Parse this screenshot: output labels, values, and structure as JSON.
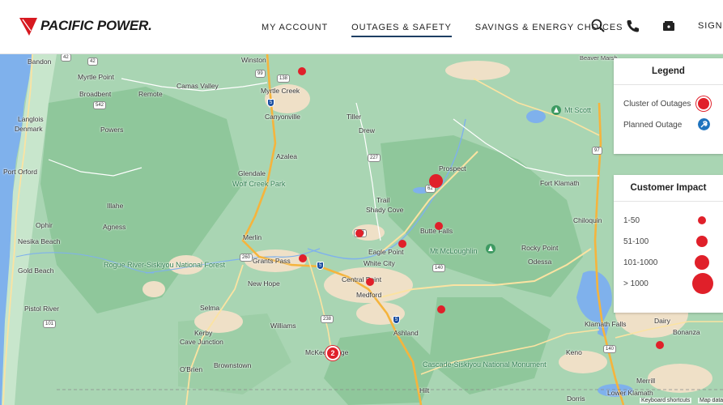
{
  "header": {
    "brand": "PACIFIC POWER.",
    "nav": [
      {
        "label": "MY ACCOUNT",
        "active": false
      },
      {
        "label": "OUTAGES & SAFETY",
        "active": true
      },
      {
        "label": "SAVINGS & ENERGY CHOICES",
        "active": false
      }
    ],
    "icons": [
      "search-icon",
      "phone-icon",
      "wallet-icon"
    ],
    "sign_in": "SIGN IN"
  },
  "legend": {
    "title": "Legend",
    "items": [
      {
        "label": "Cluster of Outages",
        "icon": "cluster-icon"
      },
      {
        "label": "Planned Outage",
        "icon": "planned-outage-icon"
      }
    ]
  },
  "customer_impact": {
    "title": "Customer Impact",
    "items": [
      {
        "label": "1-50"
      },
      {
        "label": "51-100"
      },
      {
        "label": "101-1000"
      },
      {
        "label": "> 1000"
      }
    ]
  },
  "map": {
    "places": [
      "Bandon",
      "Winston",
      "Myrtle Point",
      "Camas Valley",
      "Myrtle Creek",
      "Broadbent",
      "Remote",
      "Beaver Marsh",
      "Langlois",
      "Denmark",
      "Powers",
      "Canyonville",
      "Tiller",
      "Drew",
      "Mt Scott",
      "Azalea",
      "Prospect",
      "Port Orford",
      "Glendale",
      "Wolf Creek Park",
      "Fort Klamath",
      "Illahe",
      "Trail",
      "Shady Cove",
      "Agness",
      "Chiloquin",
      "Ophir",
      "Butte Falls",
      "Nesika Beach",
      "Merlin",
      "Eagle Point",
      "Mt McLoughlin",
      "Rocky Point",
      "Grants Pass",
      "White City",
      "Odessa",
      "Gold Beach",
      "Rogue River-Siskiyou National Forest",
      "New Hope",
      "Central Point",
      "Medford",
      "Pistol River",
      "Selma",
      "Williams",
      "Klamath Falls",
      "Kerby",
      "Cave Junction",
      "Ashland",
      "Dairy",
      "Bonanza",
      "Brownstown",
      "McKee Bridge",
      "Keno",
      "O'Brien",
      "Cascade-Siskiyou National Monument",
      "Merrill",
      "Hilt",
      "Dorris",
      "Lower Klamath"
    ],
    "highways": [
      "42",
      "99",
      "138",
      "542",
      "227",
      "62",
      "97",
      "234",
      "260",
      "5",
      "140",
      "238",
      "101"
    ],
    "outage_markers": [
      {
        "type": "1-50"
      },
      {
        "type": "51-100"
      },
      {
        "type": "1-50"
      },
      {
        "type": "1-50"
      },
      {
        "type": "1-50"
      },
      {
        "type": "1-50"
      },
      {
        "type": "1-50"
      },
      {
        "type": "1-50"
      },
      {
        "type": "1-50"
      }
    ],
    "cluster": {
      "count": "2"
    },
    "attribution": [
      "Keyboard shortcuts",
      "Map data"
    ]
  }
}
